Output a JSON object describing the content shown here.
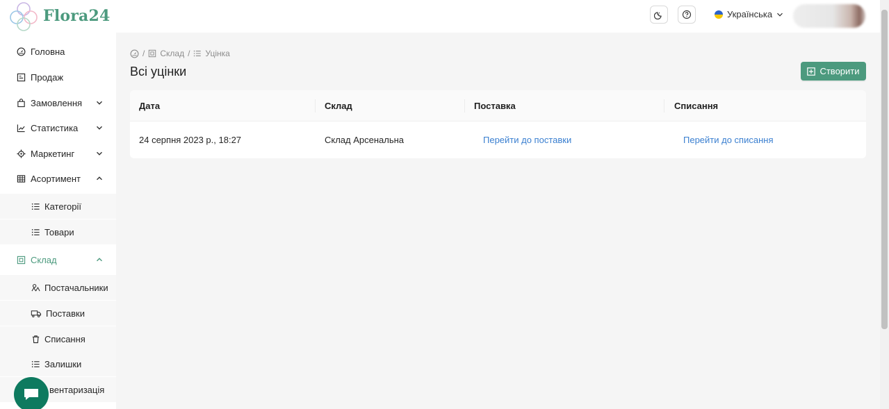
{
  "app": {
    "brand": "Flora24",
    "accent": "#4c9a7e",
    "link_color": "#3a7fd0"
  },
  "header": {
    "language": "Українська",
    "icons": [
      "theme-moon-icon",
      "help-icon",
      "chevron-down-icon"
    ]
  },
  "sidebar": {
    "items": [
      {
        "label": "Головна",
        "icon": "dashboard-icon"
      },
      {
        "label": "Продаж",
        "icon": "pos-icon"
      },
      {
        "label": "Замовлення",
        "icon": "bag-icon",
        "chevron": "down"
      },
      {
        "label": "Статистика",
        "icon": "chart-icon",
        "chevron": "down"
      },
      {
        "label": "Маркетинг",
        "icon": "target-icon",
        "chevron": "down"
      },
      {
        "label": "Асортимент",
        "icon": "grid-icon",
        "chevron": "up"
      }
    ],
    "assortment_sub": [
      {
        "label": "Категорії",
        "icon": "list-icon"
      },
      {
        "label": "Товари",
        "icon": "list-icon"
      }
    ],
    "warehouse": {
      "label": "Склад",
      "icon": "warehouse-icon",
      "chevron": "up"
    },
    "warehouse_sub": [
      {
        "label": "Постачальники",
        "icon": "suppliers-icon"
      },
      {
        "label": "Поставки",
        "icon": "truck-icon"
      },
      {
        "label": "Списання",
        "icon": "trash-icon"
      },
      {
        "label": "Залишки",
        "icon": "list-icon"
      },
      {
        "label": "вентаризація",
        "icon": "inventory-icon"
      }
    ]
  },
  "breadcrumb": {
    "sep": "/",
    "items": [
      "Склад",
      "Уцінка"
    ]
  },
  "page": {
    "title": "Всі уцінки",
    "create_label": "Створити"
  },
  "table": {
    "columns": [
      "Дата",
      "Склад",
      "Поставка",
      "Списання"
    ],
    "rows": [
      {
        "date": "24 серпня 2023 р., 18:27",
        "warehouse": "Склад Арсенальна",
        "delivery_link": "Перейти до поставки",
        "writeoff_link": "Перейти до списання"
      }
    ]
  }
}
